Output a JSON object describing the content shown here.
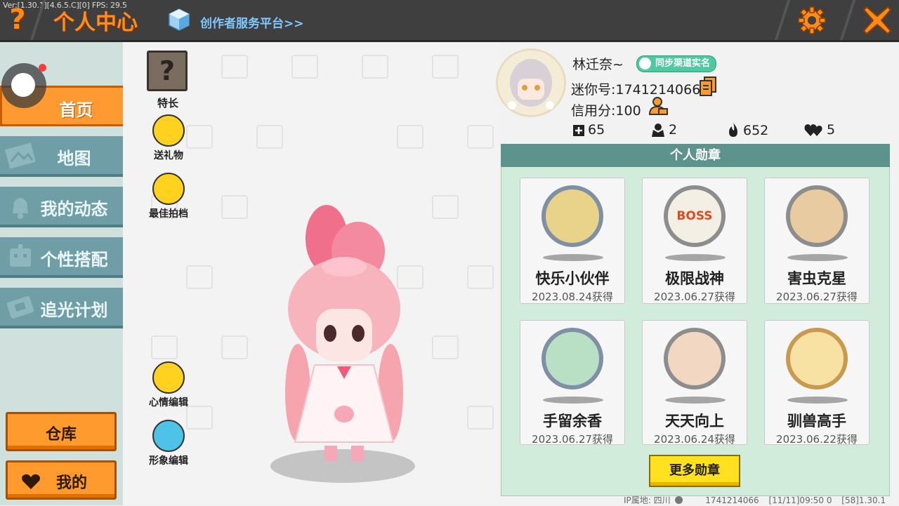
{
  "debug": "Ver:[1.30.1][4.6.5.C][0] FPS: 29.5",
  "header": {
    "help": "?",
    "title": "个人中心",
    "creator_link": "创作者服务平台>>"
  },
  "sidebar": {
    "items": [
      {
        "label": "首页",
        "icon": "house-icon"
      },
      {
        "label": "地图",
        "icon": "map-icon"
      },
      {
        "label": "我的动态",
        "icon": "bell-icon"
      },
      {
        "label": "个性搭配",
        "icon": "robot-icon"
      },
      {
        "label": "追光计划",
        "icon": "ticket-icon"
      }
    ],
    "warehouse": "仓库",
    "mine": "我的"
  },
  "actions": {
    "talent_symbol": "?",
    "talent": "特长",
    "gift": "送礼物",
    "best_partner": "最佳拍档",
    "mood_edit": "心情编辑",
    "image_edit": "形象编辑"
  },
  "profile": {
    "nickname": "林迁奈~",
    "realname_badge": "同步渠道实名",
    "mini_id": "迷你号:1741214066",
    "credit": "信用分:100",
    "stats": {
      "likes": "65",
      "fans": "2",
      "popularity": "652",
      "favorites": "5"
    }
  },
  "medals": {
    "header": "个人勋章",
    "items": [
      {
        "name": "快乐小伙伴",
        "date": "2023.08.24获得"
      },
      {
        "name": "极限战神",
        "date": "2023.06.27获得",
        "badge_text": "BOSS"
      },
      {
        "name": "害虫克星",
        "date": "2023.06.27获得"
      },
      {
        "name": "手留余香",
        "date": "2023.06.27获得"
      },
      {
        "name": "天天向上",
        "date": "2023.06.24获得"
      },
      {
        "name": "驯兽高手",
        "date": "2023.06.22获得"
      }
    ],
    "more": "更多勋章"
  },
  "footer": {
    "ip": "IP属地: 四川",
    "uid": "1741214066",
    "time": "[11/11]09:50 0",
    "version": "[58]1.30.1"
  },
  "colors": {
    "accent_orange": "#ff8c21",
    "sidebar_teal": "#6f9ea7",
    "panel_green": "#d2ecdb",
    "medal_header": "#5c938c",
    "yellow_button": "#ffe11f"
  }
}
